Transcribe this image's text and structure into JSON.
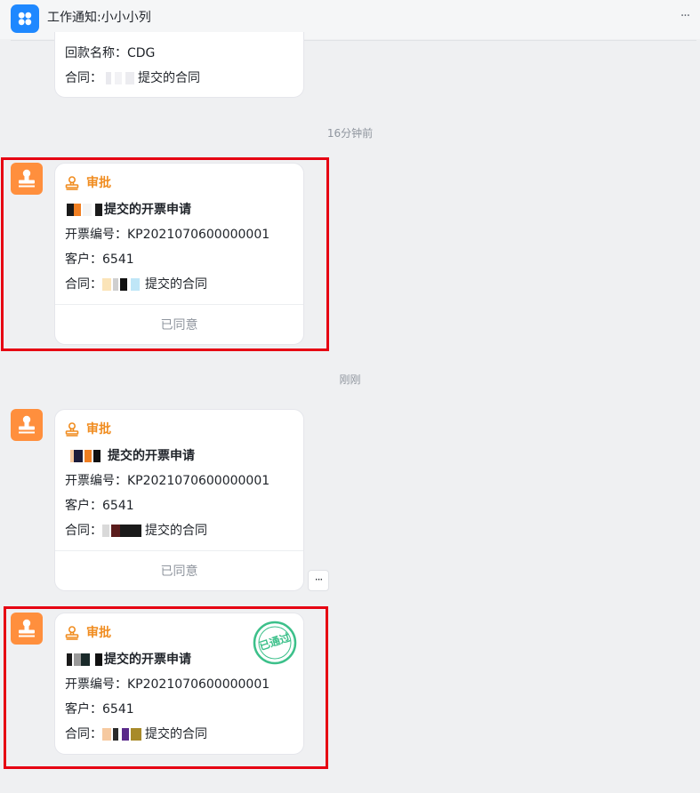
{
  "header": {
    "title": "工作通知:小小小列",
    "more": "···"
  },
  "top_card": {
    "payment_name": "回款名称：CDG",
    "contract_prefix": "合同：",
    "contract_suffix": "提交的合同"
  },
  "timestamps": [
    "16分钟前",
    "刚刚"
  ],
  "approval_cards": [
    {
      "tag": "审批",
      "title_suffix": "提交的开票申请",
      "invoice_no": "开票编号：KP2021070600000001",
      "customer": "客户：6541",
      "contract_prefix": "合同：",
      "contract_suffix": "提交的合同",
      "footer": "已同意"
    },
    {
      "tag": "审批",
      "title_suffix": "提交的开票申请",
      "invoice_no": "开票编号：KP2021070600000001",
      "customer": "客户：6541",
      "contract_prefix": "合同：",
      "contract_suffix": "提交的合同",
      "footer": "已同意"
    },
    {
      "tag": "审批",
      "title_suffix": "提交的开票申请",
      "invoice_no": "开票编号：KP2021070600000001",
      "customer": "客户：6541",
      "contract_prefix": "合同：",
      "contract_suffix": "提交的合同",
      "stamp_text": "已通过"
    }
  ],
  "message_more": "···",
  "colors": {
    "accent": "#1e88ff",
    "approval_orange": "#f08c1f",
    "avatar_orange": "#ff8f3d",
    "highlight_red": "#e60012",
    "stamp_green": "#3cc08a"
  },
  "icons": {
    "app": "app-grid-icon",
    "avatar": "approval-stamp-icon",
    "tag": "stamp-icon",
    "more": "more-dots-icon"
  }
}
